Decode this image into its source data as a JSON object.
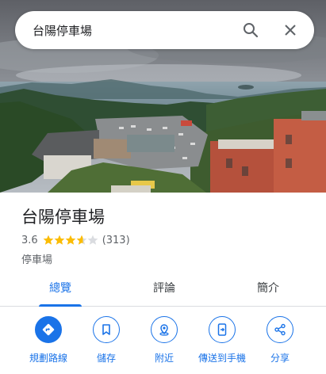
{
  "search": {
    "query": "台陽停車場"
  },
  "place": {
    "name": "台陽停車場",
    "rating": "3.6",
    "rating_value": 3.6,
    "review_count": "(313)",
    "category": "停車場"
  },
  "tabs": [
    {
      "label": "總覽",
      "active": true
    },
    {
      "label": "評論",
      "active": false
    },
    {
      "label": "簡介",
      "active": false
    }
  ],
  "actions": [
    {
      "label": "規劃路線",
      "icon": "directions-icon"
    },
    {
      "label": "儲存",
      "icon": "bookmark-icon"
    },
    {
      "label": "附近",
      "icon": "nearby-icon"
    },
    {
      "label": "傳送到手機",
      "icon": "send-to-phone-icon"
    },
    {
      "label": "分享",
      "icon": "share-icon"
    }
  ],
  "colors": {
    "accent": "#1a73e8",
    "star": "#fbbc04",
    "star_empty": "#dadce0"
  }
}
